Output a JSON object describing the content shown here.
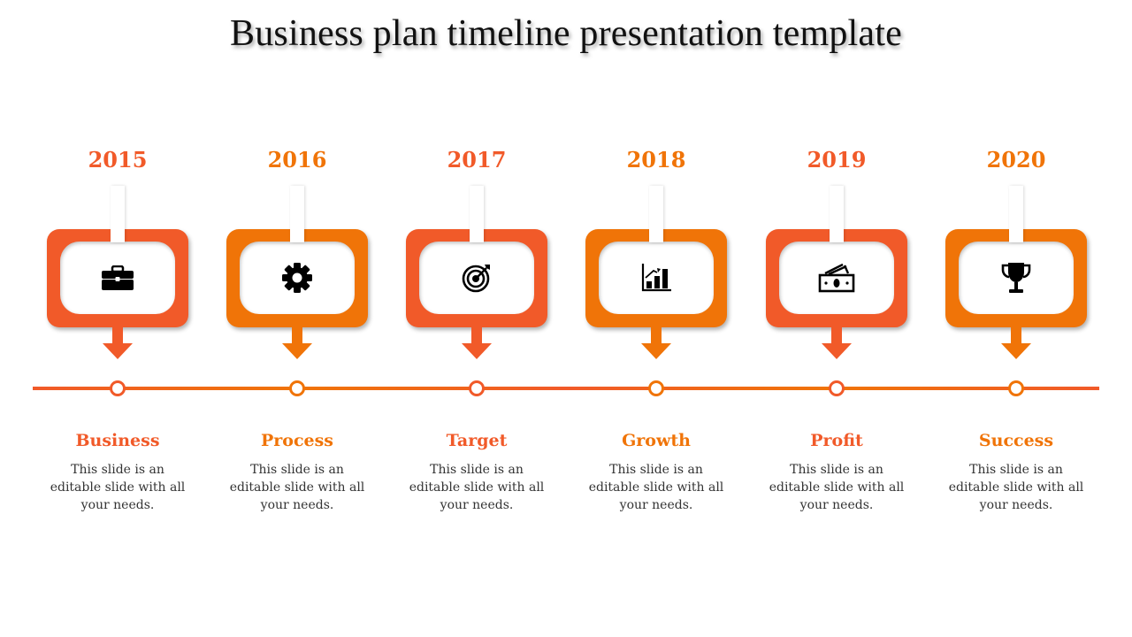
{
  "title": "Business plan timeline presentation template",
  "colors": {
    "primary": "#F15A29",
    "secondary": "#F07408",
    "text": "#333333",
    "title": "#111111"
  },
  "items": [
    {
      "year": "2015",
      "label": "Business",
      "description": "This slide is an editable slide with all your needs.",
      "icon": "briefcase-icon",
      "color": "#F15A29"
    },
    {
      "year": "2016",
      "label": "Process",
      "description": "This slide is an editable slide with all your needs.",
      "icon": "gear-icon",
      "color": "#F07408"
    },
    {
      "year": "2017",
      "label": "Target",
      "description": "This slide is an editable slide with all your needs.",
      "icon": "target-icon",
      "color": "#F15A29"
    },
    {
      "year": "2018",
      "label": "Growth",
      "description": "This slide is an editable slide with all your needs.",
      "icon": "growth-chart-icon",
      "color": "#F07408"
    },
    {
      "year": "2019",
      "label": "Profit",
      "description": "This slide is an editable slide with all your needs.",
      "icon": "money-icon",
      "color": "#F15A29"
    },
    {
      "year": "2020",
      "label": "Success",
      "description": "This slide is an editable slide with all your needs.",
      "icon": "trophy-icon",
      "color": "#F07408"
    }
  ]
}
